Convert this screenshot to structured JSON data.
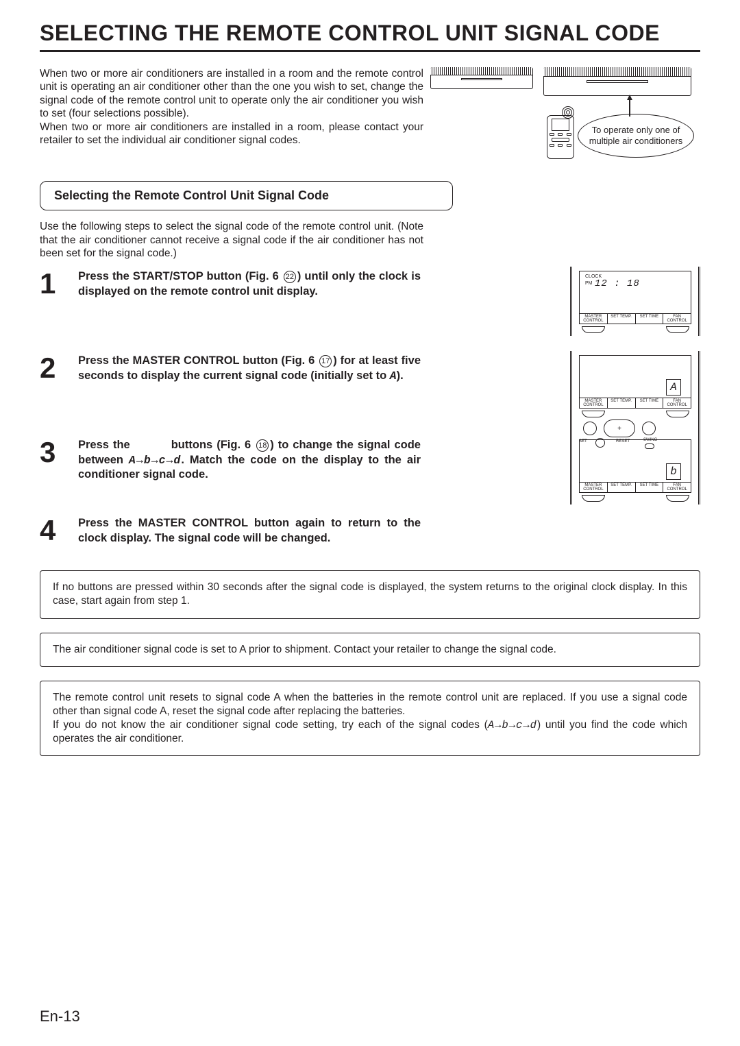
{
  "title": "SELECTING THE REMOTE CONTROL UNIT SIGNAL CODE",
  "intro": {
    "p1": "When two or more air conditioners are installed in a room and the remote control unit is operating an air conditioner other than the one you wish to set, change the signal code of the remote control unit to operate only the air conditioner you wish to set (four selections possible).",
    "p2": "When two or more air conditioners are installed in a room, please contact your retailer to set the individual air conditioner signal codes."
  },
  "callout": "To operate only one of multiple air conditioners",
  "section_label": "Selecting the Remote Control Unit Signal Code",
  "sub_intro": "Use the following steps to select the signal code of the remote control unit. (Note that the air conditioner cannot receive a signal code if the air conditioner has not been set for the signal code.)",
  "steps": {
    "s1": {
      "num": "1",
      "pre": "Press the START/STOP button (Fig. 6 ",
      "ref": "22",
      "post": ") until only the clock is displayed on the remote control unit display."
    },
    "s2": {
      "num": "2",
      "pre": "Press the MASTER CONTROL button (Fig. 6 ",
      "ref": "17",
      "post": ") for at least five seconds to display the current signal code (initially set to ",
      "code": "A",
      "tail": ")."
    },
    "s3": {
      "num": "3",
      "pre": "Press the          buttons (Fig. 6 ",
      "ref": "18",
      "mid": ") to change the signal code between ",
      "codes": "A→b→c→d",
      "post": ". Match the code on the display to the air conditioner signal code."
    },
    "s4": {
      "num": "4",
      "text": "Press the MASTER CONTROL button again to return to the clock display. The signal code will be changed."
    }
  },
  "lcd": {
    "clock_label": "CLOCK",
    "pm": "PM",
    "time": "12 : 18",
    "btn_labels": [
      "MASTER CONTROL",
      "SET TEMP.",
      "SET TIME",
      "FAN CONTROL"
    ],
    "codeA": "A",
    "codeB": "b",
    "set": "SET",
    "reset": "RESET",
    "swing": "SWING",
    "plus": "+"
  },
  "notes": {
    "n1": "If no buttons are pressed within 30 seconds after the signal code is displayed, the system returns to the original clock display. In this case, start again from step 1.",
    "n2": "The air conditioner signal code is set to A prior to shipment. Contact your retailer to change the signal code.",
    "n3a": "The remote control unit resets to signal code A when the batteries in the remote control unit are replaced. If you use a signal code other than signal code A, reset the signal code after replacing the batteries.",
    "n3b_pre": "If you do not know the air conditioner signal code setting, try each of the signal codes (",
    "n3b_codes": "A→b→c→d",
    "n3b_post": ") until you find the code which operates the air conditioner."
  },
  "page_num": "En-13"
}
